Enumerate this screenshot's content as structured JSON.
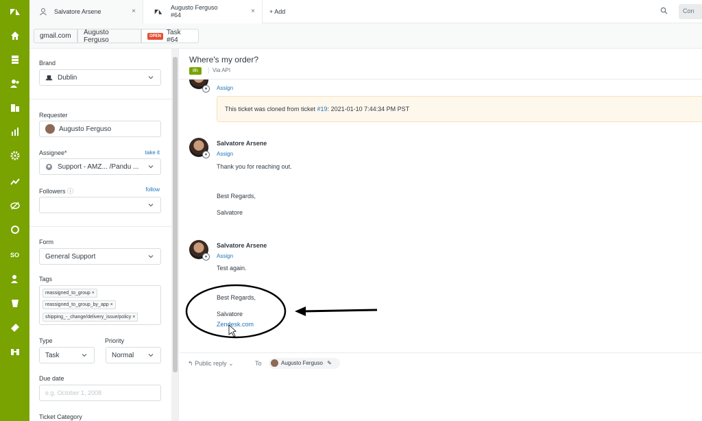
{
  "tabs": [
    {
      "label": "Salvatore Arsene",
      "close": "×"
    },
    {
      "label_line1": "Augusto Ferguso",
      "label_line2": "#64",
      "close": "×"
    }
  ],
  "add_tab_label": "+ Add",
  "conversations_label": "Con",
  "breadcrumb": {
    "org": "gmail.com",
    "user": "Augusto Ferguso",
    "status_badge": "OPEN",
    "ticket": "Task #64"
  },
  "sidebar": {
    "brand_label": "Brand",
    "brand_value": "Dublin",
    "requester_label": "Requester",
    "requester_value": "Augusto Ferguso",
    "assignee_label": "Assignee*",
    "take_it": "take it",
    "assignee_value": "Support - AMZ... /Pandu ...",
    "followers_label": "Followers",
    "follow": "follow",
    "form_label": "Form",
    "form_value": "General Support",
    "tags_label": "Tags",
    "tags": [
      "reassigned_to_group",
      "reassigned_to_group_by_app",
      "shipping_-_change/delivery_issue/policy"
    ],
    "type_label": "Type",
    "type_value": "Task",
    "priority_label": "Priority",
    "priority_value": "Normal",
    "due_label": "Due date",
    "due_placeholder": "e.g. October 1, 2008",
    "ticket_category_label": "Ticket Category"
  },
  "ticket": {
    "subject": "Where's my order?",
    "age": "8h",
    "via": "Via API"
  },
  "conversation": {
    "first_assign": "Assign",
    "note_prefix": "This ticket was cloned from ticket ",
    "note_link": "#19",
    "note_suffix": ": 2021-01-10 7:44:34 PM PST",
    "messages": [
      {
        "author": "Salvatore Arsene",
        "assign": "Assign",
        "line1": "Thank you for reaching out.",
        "line2": "Best Regards,",
        "line3": "Salvatore"
      },
      {
        "author": "Salvatore Arsene",
        "assign": "Assign",
        "line1": "Test again.",
        "line2": "Best Regards,",
        "line3": "Salvatore",
        "link": "Zendesk.com"
      }
    ]
  },
  "reply": {
    "mode": "Public reply",
    "to_label": "To",
    "recipient": "Augusto Ferguso"
  },
  "colors": {
    "rail": "#78a300",
    "open_badge": "#e34f32",
    "link": "#1f73b7"
  }
}
